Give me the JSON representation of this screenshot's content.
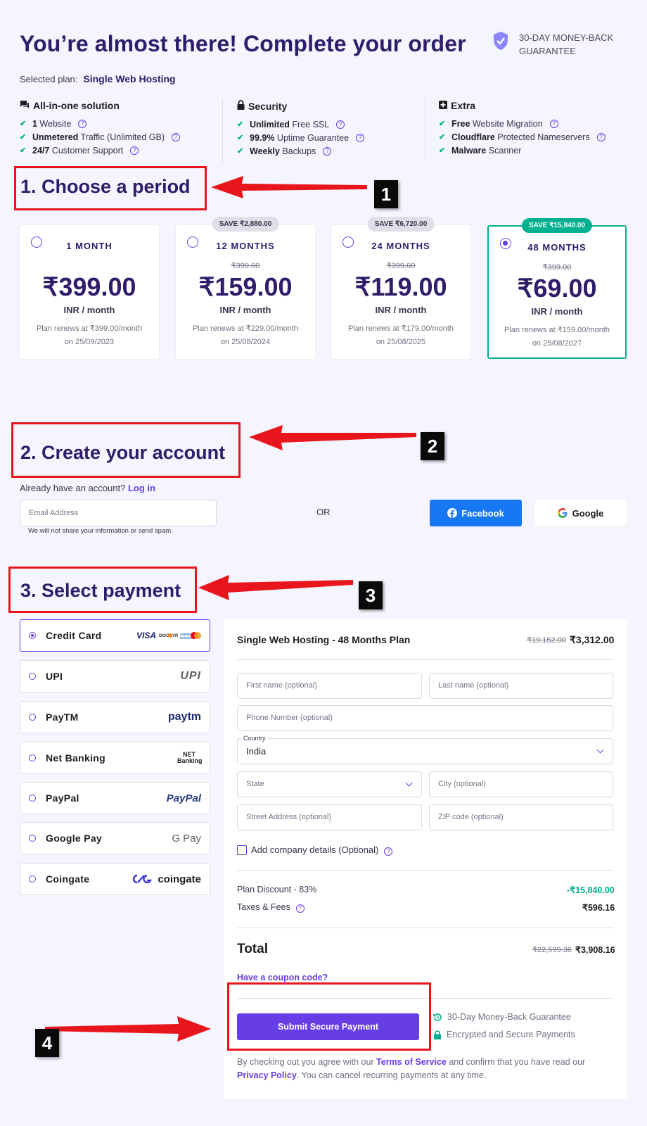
{
  "header": {
    "title": "You’re almost there! Complete your order",
    "guarantee": "30-DAY MONEY-BACK GUARANTEE",
    "selected_plan_label": "Selected plan:",
    "selected_plan": "Single Web Hosting"
  },
  "features": [
    {
      "heading": "All-in-one solution",
      "items": [
        {
          "bold": "1",
          "rest": " Website"
        },
        {
          "bold": "Unmetered",
          "rest": " Traffic (Unlimited GB)"
        },
        {
          "bold": "24/7",
          "rest": " Customer Support"
        }
      ]
    },
    {
      "heading": "Security",
      "items": [
        {
          "bold": "Unlimited",
          "rest": " Free SSL"
        },
        {
          "bold": "99.9%",
          "rest": " Uptime Guarantee"
        },
        {
          "bold": "Weekly",
          "rest": " Backups"
        }
      ]
    },
    {
      "heading": "Extra",
      "items": [
        {
          "bold": "Free",
          "rest": " Website Migration"
        },
        {
          "bold": "Cloudflare",
          "rest": " Protected Nameservers"
        },
        {
          "bold": "Malware",
          "rest": " Scanner"
        }
      ]
    }
  ],
  "steps": {
    "s1": "1. Choose a period",
    "s2": "2. Create your account",
    "s3": "3. Select payment",
    "n1": "1",
    "n2": "2",
    "n3": "3",
    "n4": "4"
  },
  "plans": [
    {
      "period": "1 MONTH",
      "save": "",
      "old": "",
      "price": "₹399.00",
      "unit": "INR / month",
      "renew1": "Plan renews at ₹399.00/month",
      "renew2": "on 25/09/2023"
    },
    {
      "period": "12 MONTHS",
      "save": "SAVE ₹2,880.00",
      "old": "₹399.00",
      "price": "₹159.00",
      "unit": "INR / month",
      "renew1": "Plan renews at ₹229.00/month",
      "renew2": "on 25/08/2024"
    },
    {
      "period": "24 MONTHS",
      "save": "SAVE ₹6,720.00",
      "old": "₹399.00",
      "price": "₹119.00",
      "unit": "INR / month",
      "renew1": "Plan renews at ₹179.00/month",
      "renew2": "on 25/08/2025"
    },
    {
      "period": "48 MONTHS",
      "save": "SAVE ₹15,840.00",
      "old": "₹399.00",
      "price": "₹69.00",
      "unit": "INR / month",
      "renew1": "Plan renews at ₹159.00/month",
      "renew2": "on 25/08/2027"
    }
  ],
  "account": {
    "already": "Already have an account?",
    "login": "Log in",
    "email_placeholder": "Email Address",
    "spam_note": "We will not share your information or send spam.",
    "or": "OR",
    "facebook": "Facebook",
    "google": "Google"
  },
  "payment_methods": [
    {
      "name": "Credit Card",
      "logo": "VISA"
    },
    {
      "name": "UPI",
      "logo": "UPI"
    },
    {
      "name": "PayTM",
      "logo": "paytm"
    },
    {
      "name": "Net Banking",
      "logo": "NET Banking"
    },
    {
      "name": "PayPal",
      "logo": "PayPal"
    },
    {
      "name": "Google Pay",
      "logo": "G Pay"
    },
    {
      "name": "Coingate",
      "logo": "coingate"
    }
  ],
  "checkout": {
    "plan_title": "Single Web Hosting - 48 Months Plan",
    "plan_old": "₹19,152.00",
    "plan_new": "₹3,312.00",
    "first_name": "First name (optional)",
    "last_name": "Last name (optional)",
    "phone": "Phone Number (optional)",
    "country_label": "Country",
    "country": "India",
    "state": "State",
    "city": "City (optional)",
    "street": "Street Address (optional)",
    "zip": "ZIP code (optional)",
    "company": "Add company details (Optional)",
    "discount_label": "Plan Discount - 83%",
    "discount_value": "-₹15,840.00",
    "taxes_label": "Taxes & Fees",
    "taxes_value": "₹596.16",
    "total_label": "Total",
    "total_old": "₹22,599.36",
    "total_new": "₹3,908.16",
    "coupon": "Have a coupon code?",
    "submit": "Submit Secure Payment",
    "guarantee": "30-Day Money-Back Guarantee",
    "secure": "Encrypted and Secure Payments",
    "terms_1": "By checking out you agree with our ",
    "terms_link": "Terms of Service",
    "terms_2": " and confirm that you have read our",
    "privacy_link": "Privacy Policy",
    "terms_3": ". You can cancel recurring payments at any time."
  },
  "colors": {
    "accent": "#673de6",
    "success": "#00b090",
    "annotation": "#e8161c",
    "facebook": "#1877f2"
  }
}
